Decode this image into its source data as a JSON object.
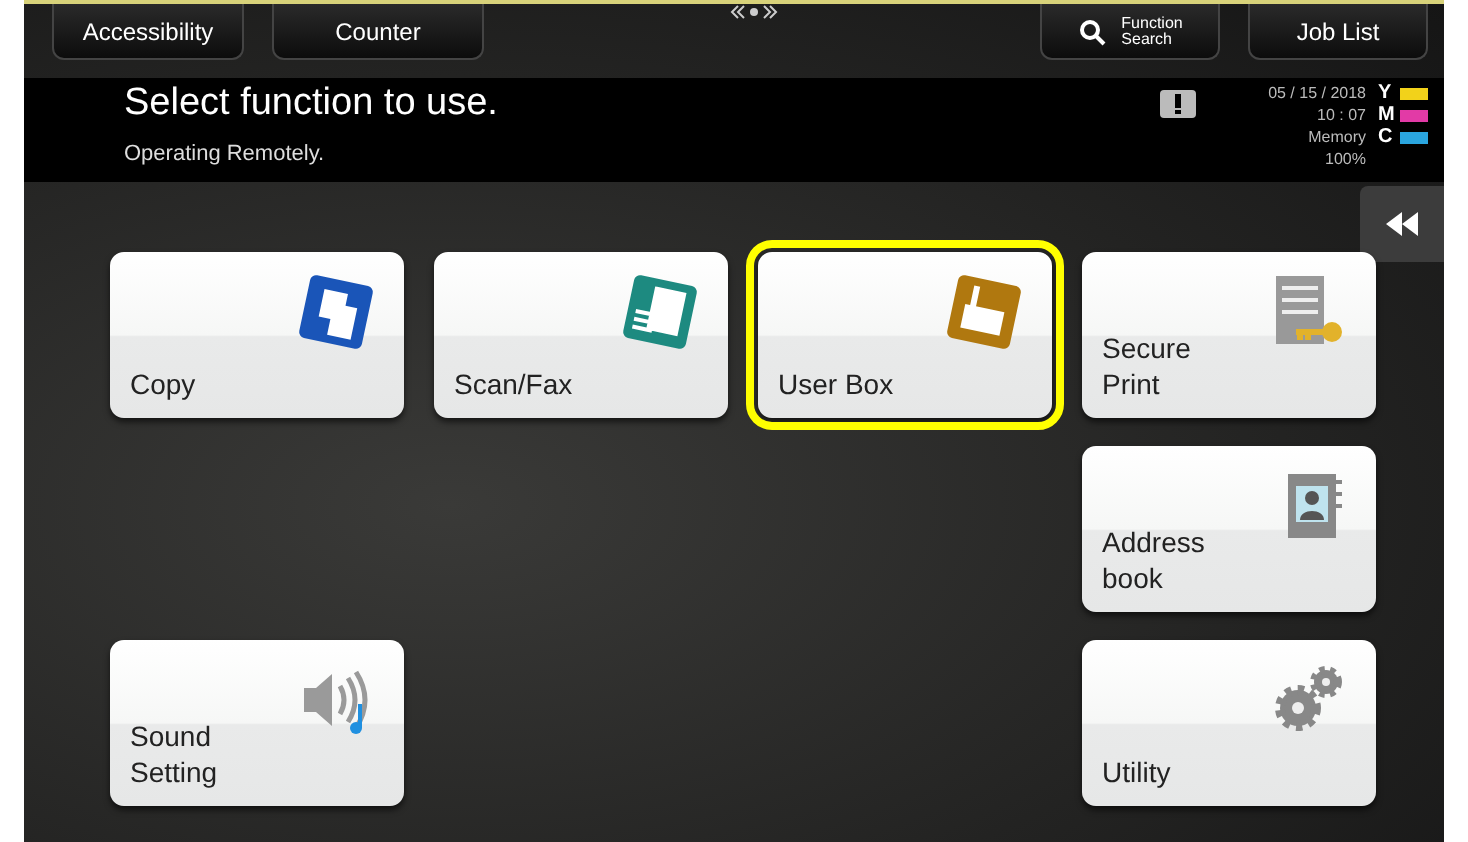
{
  "top_bar": {
    "left_buttons": [
      "Accessibility",
      "Counter"
    ],
    "function_search": "Function\nSearch",
    "job_list": "Job List"
  },
  "header": {
    "title": "Select function to use.",
    "message": "Operating Remotely.",
    "date": "05 / 15 / 2018",
    "time": "10 : 07",
    "memory_label": "Memory",
    "memory_value": "100%",
    "toners": [
      {
        "label": "Y",
        "color": "#f2d21a"
      },
      {
        "label": "M",
        "color": "#e23aa6"
      },
      {
        "label": "C",
        "color": "#2aa5de"
      }
    ]
  },
  "tiles": [
    {
      "label": "Copy",
      "selected": false
    },
    {
      "label": "Scan/Fax",
      "selected": false
    },
    {
      "label": "User Box",
      "selected": true
    },
    {
      "label": "Secure\nPrint",
      "selected": false
    },
    {
      "label": "Address\nbook",
      "selected": false
    },
    {
      "label": "Sound\nSetting",
      "selected": false
    },
    {
      "label": "Utility",
      "selected": false
    }
  ]
}
